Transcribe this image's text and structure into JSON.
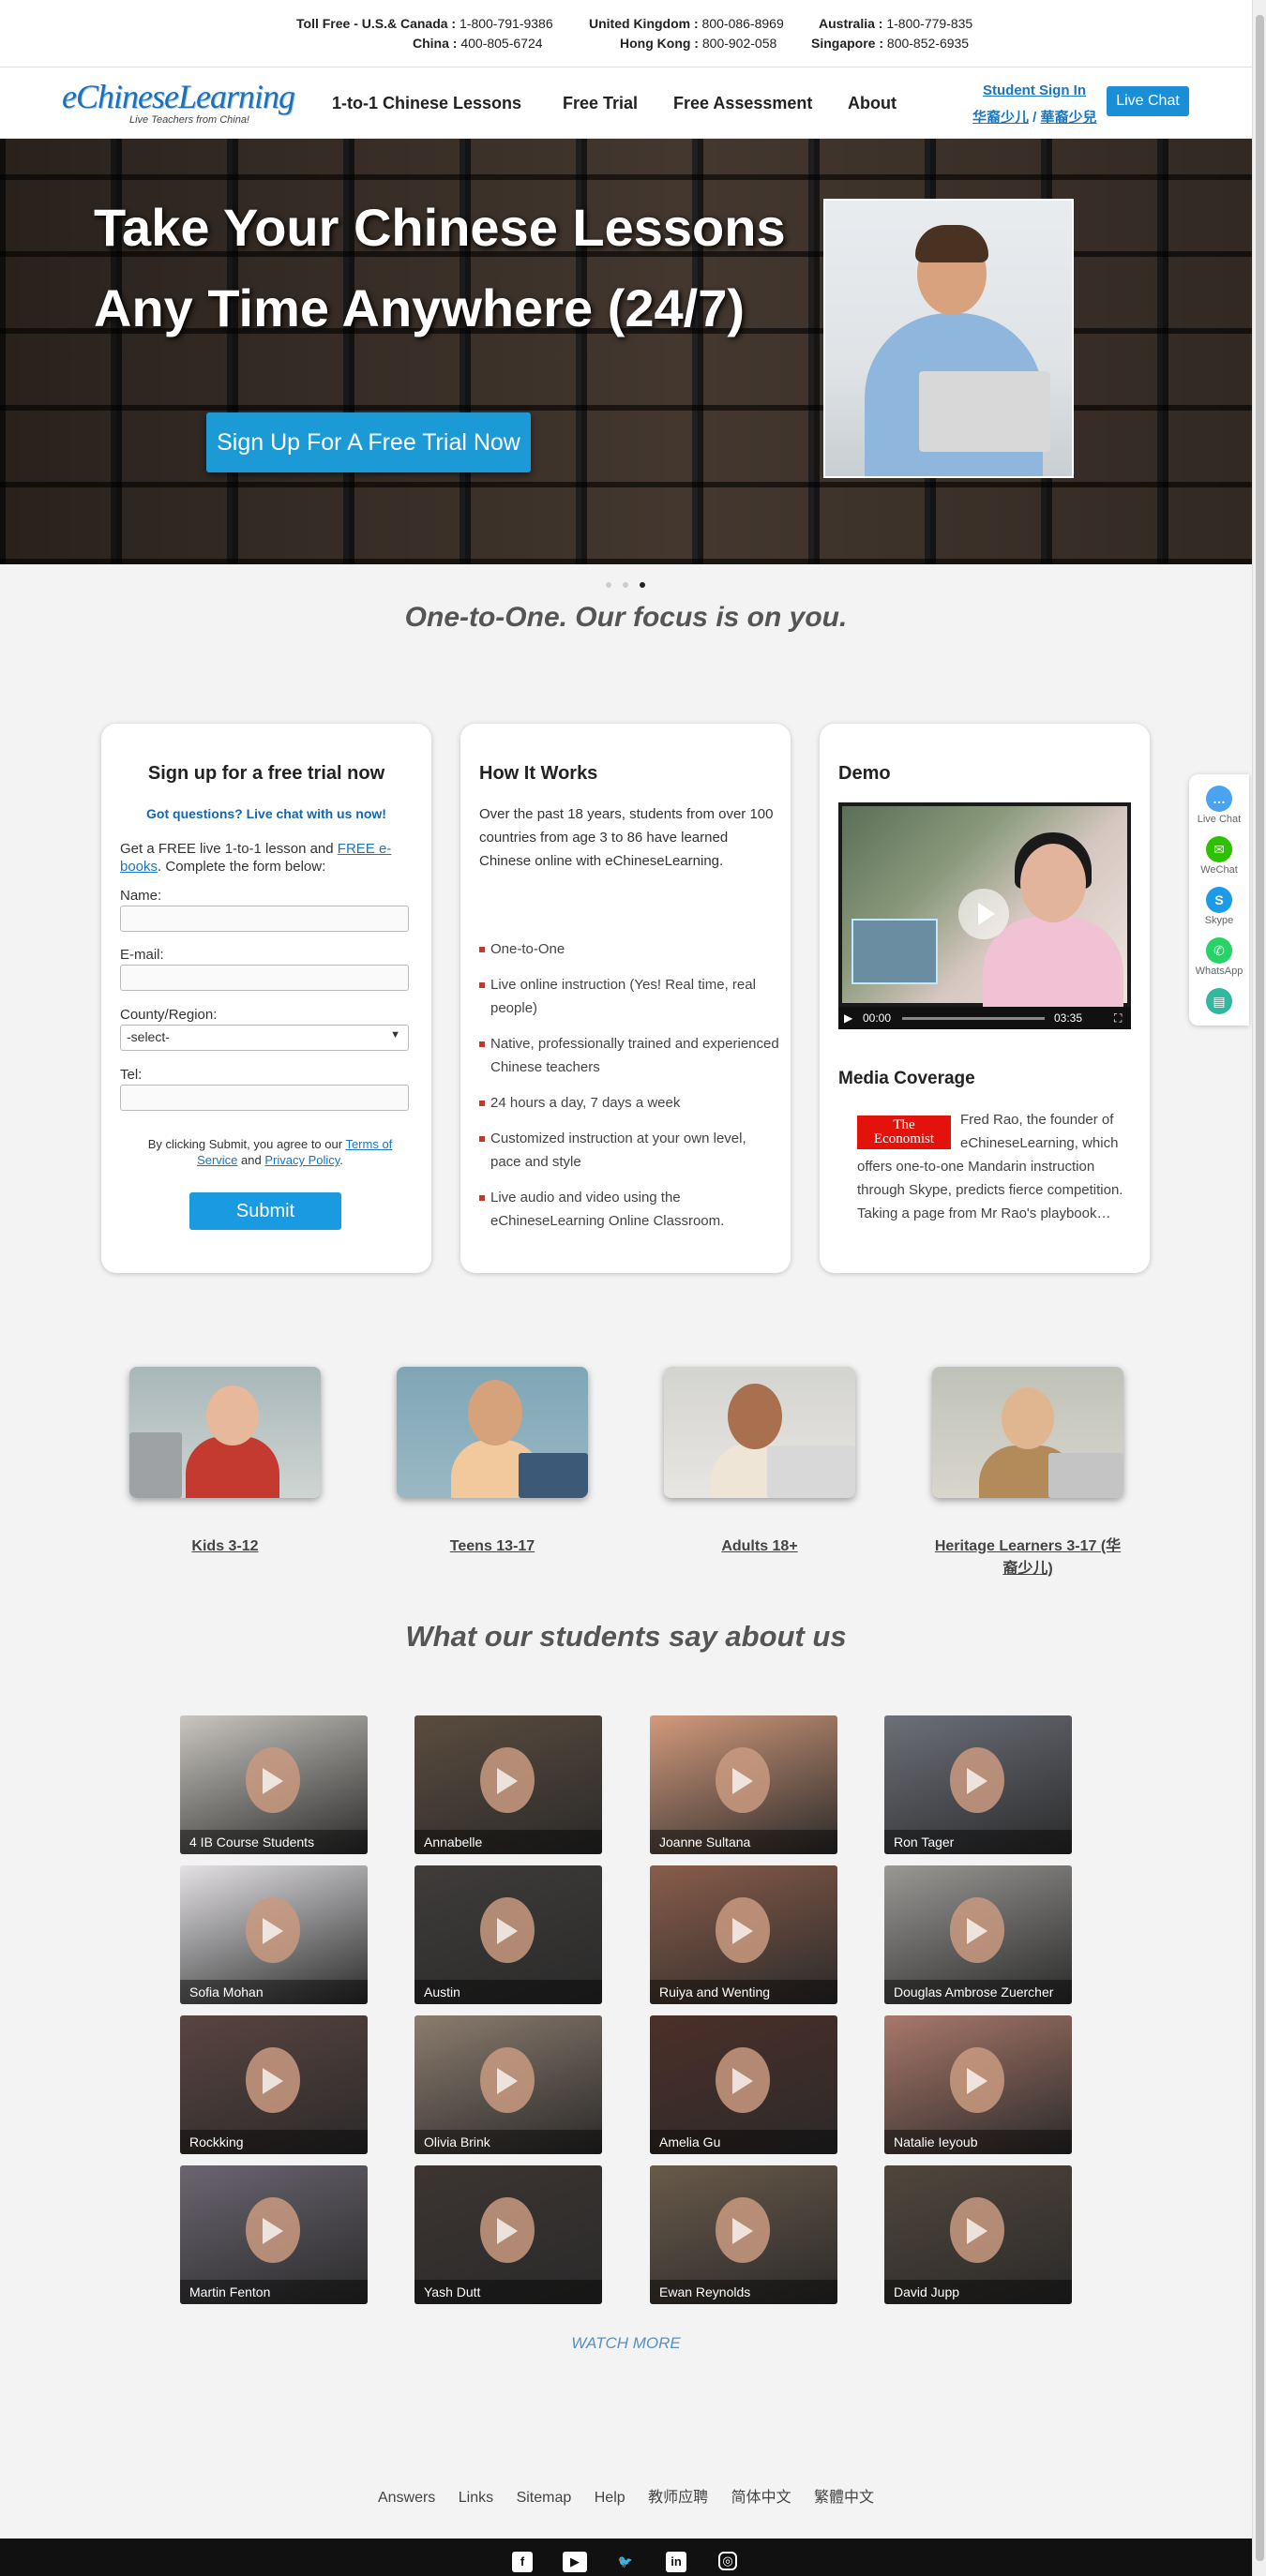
{
  "phones": [
    {
      "label": "Toll Free - U.S.& Canada :",
      "number": "1-800-791-9386"
    },
    {
      "label": "United Kingdom :",
      "number": "800-086-8969"
    },
    {
      "label": "Australia :",
      "number": "1-800-779-835"
    },
    {
      "label": "China :",
      "number": "400-805-6724"
    },
    {
      "label": "Hong Kong :",
      "number": "800-902-058"
    },
    {
      "label": "Singapore :",
      "number": "800-852-6935"
    }
  ],
  "logo": {
    "name": "eChineseLearning",
    "tagline": "Live Teachers from China!"
  },
  "nav": {
    "items": [
      "1-to-1 Chinese Lessons",
      "Free Trial",
      "Free Assessment",
      "About"
    ],
    "student_sign_in": "Student Sign In",
    "kids_simplified": "华裔少儿",
    "kids_separator": " / ",
    "kids_traditional": "華裔少兒",
    "live_chat": "Live Chat"
  },
  "hero": {
    "title_line1": "Take Your Chinese Lessons",
    "title_line2": "Any Time Anywhere (24/7)",
    "cta": "Sign Up For A Free Trial Now"
  },
  "tagline": "One-to-One. Our focus is on you.",
  "signup": {
    "title": "Sign up for a free trial now",
    "got_questions": "Got questions? Live chat with us now!",
    "intro_pre": "Get a FREE live 1-to-1 lesson and ",
    "intro_link": "FREE e-books",
    "intro_post": ". Complete the form below:",
    "name_label": "Name:",
    "email_label": "E-mail:",
    "region_label": "County/Region:",
    "region_value": "-select-",
    "tel_label": "Tel:",
    "terms_pre": "By clicking Submit, you agree to our ",
    "terms_link": "Terms of Service",
    "terms_and": " and ",
    "privacy_link": "Privacy Policy",
    "terms_end": ".",
    "submit": "Submit"
  },
  "how_it_works": {
    "title": "How It Works",
    "paragraph": "Over the past 18 years, students from over 100 countries from age 3 to 86 have learned Chinese online with eChineseLearning.",
    "items": [
      "One-to-One",
      "Live online instruction (Yes! Real time, real people)",
      "Native, professionally trained and experienced Chinese teachers",
      "24 hours a day, 7 days a week",
      "Customized instruction at your own level, pace and style",
      "Live audio and video using the eChineseLearning Online Classroom."
    ]
  },
  "demo": {
    "title": "Demo",
    "time_current": "00:00",
    "time_total": "03:35",
    "media_title": "Media Coverage",
    "economist_line1": "The",
    "economist_line2": "Economist",
    "media_text": "Fred Rao, the founder of eChineseLearning, which offers one-to-one Mandarin instruction through Skype, predicts fierce competition. Taking a page from Mr Rao's playbook…"
  },
  "age_groups": [
    {
      "label": "Kids 3-12"
    },
    {
      "label": "Teens 13-17"
    },
    {
      "label": "Adults 18+"
    },
    {
      "label": "Heritage Learners 3-17 (华裔少儿)"
    }
  ],
  "testimonials_title": "What our students say about us",
  "testimonials": [
    {
      "name": "4 IB Course Students",
      "bg": "#c9c6c0"
    },
    {
      "name": "Annabelle",
      "bg": "#5b4c3e"
    },
    {
      "name": "Joanne Sultana",
      "bg": "#d39a7c"
    },
    {
      "name": "Ron Tager",
      "bg": "#6d7079"
    },
    {
      "name": "Sofia Mohan",
      "bg": "#e3e1e4"
    },
    {
      "name": "Austin",
      "bg": "#3f3c3a"
    },
    {
      "name": "Ruiya and Wenting",
      "bg": "#8a5d4a"
    },
    {
      "name": "Douglas Ambrose Zuercher",
      "bg": "#9a9895"
    },
    {
      "name": "Rockking",
      "bg": "#5a4440"
    },
    {
      "name": "Olivia Brink",
      "bg": "#8c7c6e"
    },
    {
      "name": "Amelia Gu",
      "bg": "#4d2f28"
    },
    {
      "name": "Natalie Ieyoub",
      "bg": "#a9786a"
    },
    {
      "name": "Martin Fenton",
      "bg": "#6b6570"
    },
    {
      "name": "Yash Dutt",
      "bg": "#3c3532"
    },
    {
      "name": "Ewan Reynolds",
      "bg": "#6a5a4a"
    },
    {
      "name": "David Jupp",
      "bg": "#51463c"
    }
  ],
  "watch_more": "WATCH MORE",
  "footer_links": [
    "Answers",
    "Links",
    "Sitemap",
    "Help",
    "教师应聘",
    "简体中文",
    "繁體中文"
  ],
  "social_icons": [
    "facebook-icon",
    "youtube-icon",
    "twitter-icon",
    "linkedin-icon",
    "instagram-icon"
  ],
  "float_widget": [
    {
      "label": "Live Chat",
      "color": "#4aa3f0"
    },
    {
      "label": "WeChat",
      "color": "#2dc100"
    },
    {
      "label": "Skype",
      "color": "#1c9be6"
    },
    {
      "label": "WhatsApp",
      "color": "#25d366"
    },
    {
      "label": "",
      "color": "#32b8a0"
    }
  ],
  "colors": {
    "accent": "#1a8fd6",
    "link": "#1976c2",
    "bullet": "#c0392b"
  }
}
